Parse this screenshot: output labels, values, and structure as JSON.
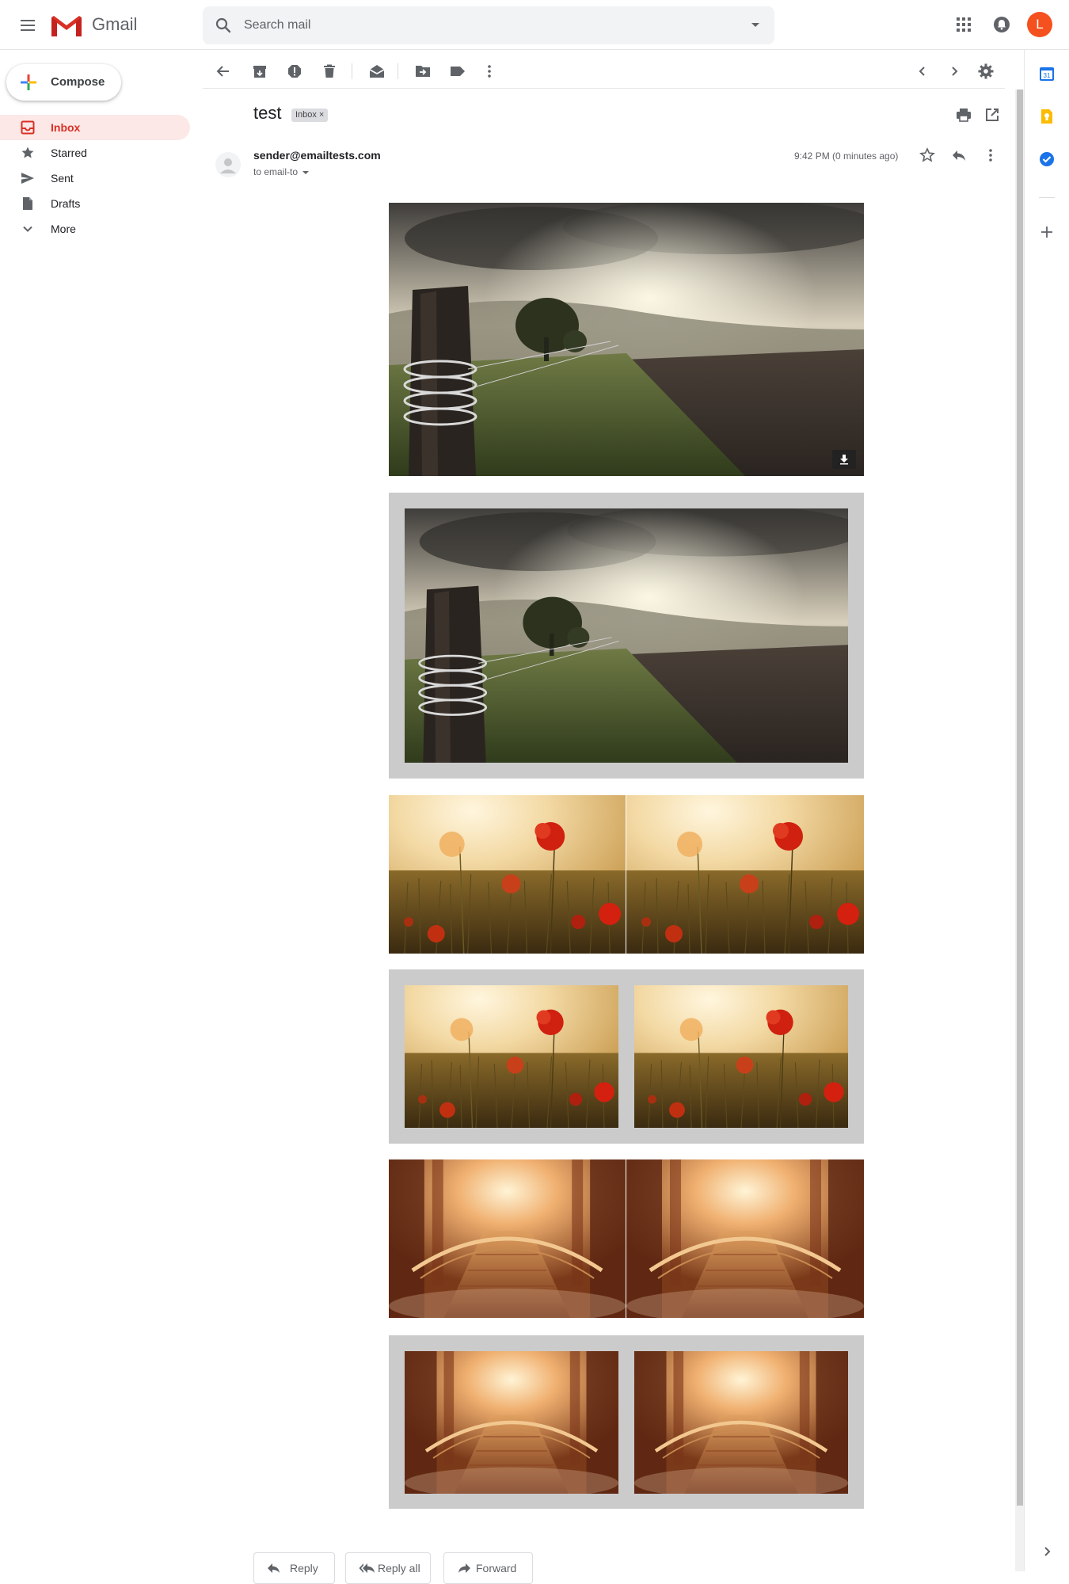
{
  "header": {
    "brand": "Gmail",
    "search_placeholder": "Search mail",
    "avatar_letter": "L"
  },
  "compose_label": "Compose",
  "nav": [
    {
      "label": "Inbox",
      "icon": "inbox-icon",
      "active": true
    },
    {
      "label": "Starred",
      "icon": "star-icon",
      "active": false
    },
    {
      "label": "Sent",
      "icon": "send-icon",
      "active": false
    },
    {
      "label": "Drafts",
      "icon": "draft-icon",
      "active": false
    },
    {
      "label": "More",
      "icon": "chevron-down-icon",
      "active": false
    }
  ],
  "message": {
    "subject": "test",
    "label_chip": "Inbox",
    "sender": "sender@emailtests.com",
    "recipient": "to email-to",
    "time": "9:42 PM (0 minutes ago)"
  },
  "images": [
    {
      "name": "landscape-image",
      "scene": "misty-field-with-fence-post",
      "framed": false
    },
    {
      "name": "landscape-image-framed",
      "scene": "misty-field-with-fence-post",
      "framed": true
    },
    {
      "name": "poppy-image-pair",
      "scene": "red-poppies-at-sunset",
      "framed": false
    },
    {
      "name": "poppy-image-pair-framed",
      "scene": "red-poppies-at-sunset",
      "framed": true
    },
    {
      "name": "bridge-image-pair",
      "scene": "sunlit-bridge-in-forest",
      "framed": false
    },
    {
      "name": "bridge-image-pair-framed",
      "scene": "sunlit-bridge-in-forest",
      "framed": true
    }
  ],
  "actions": {
    "reply": "Reply",
    "reply_all": "Reply all",
    "forward": "Forward"
  },
  "colors": {
    "accent_red": "#d93025",
    "active_nav_bg": "#fce8e6",
    "avatar_bg": "#f4511e",
    "frame_gray": "#cbcbcb"
  }
}
